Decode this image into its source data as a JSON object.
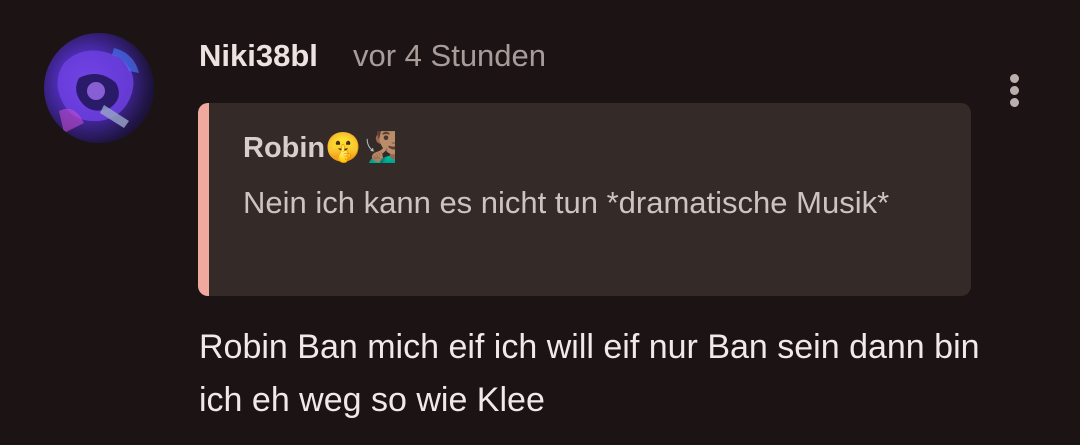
{
  "comment": {
    "username": "Niki38bl",
    "timestamp": "vor 4 Stunden",
    "quote": {
      "author": "Robin",
      "author_emojis": "🤫🧏🏽‍♂️",
      "text": "Nein ich kann es nicht tun *dramatische Musik*"
    },
    "body": "Robin Ban mich eif ich will eif nur Ban sein dann bin ich eh weg so wie Klee"
  },
  "colors": {
    "background": "#1c1414",
    "quote_background": "#342a28",
    "quote_accent": "#f0a99e",
    "timestamp": "#a89c9a"
  },
  "icons": {
    "more": "more-vertical-icon"
  }
}
